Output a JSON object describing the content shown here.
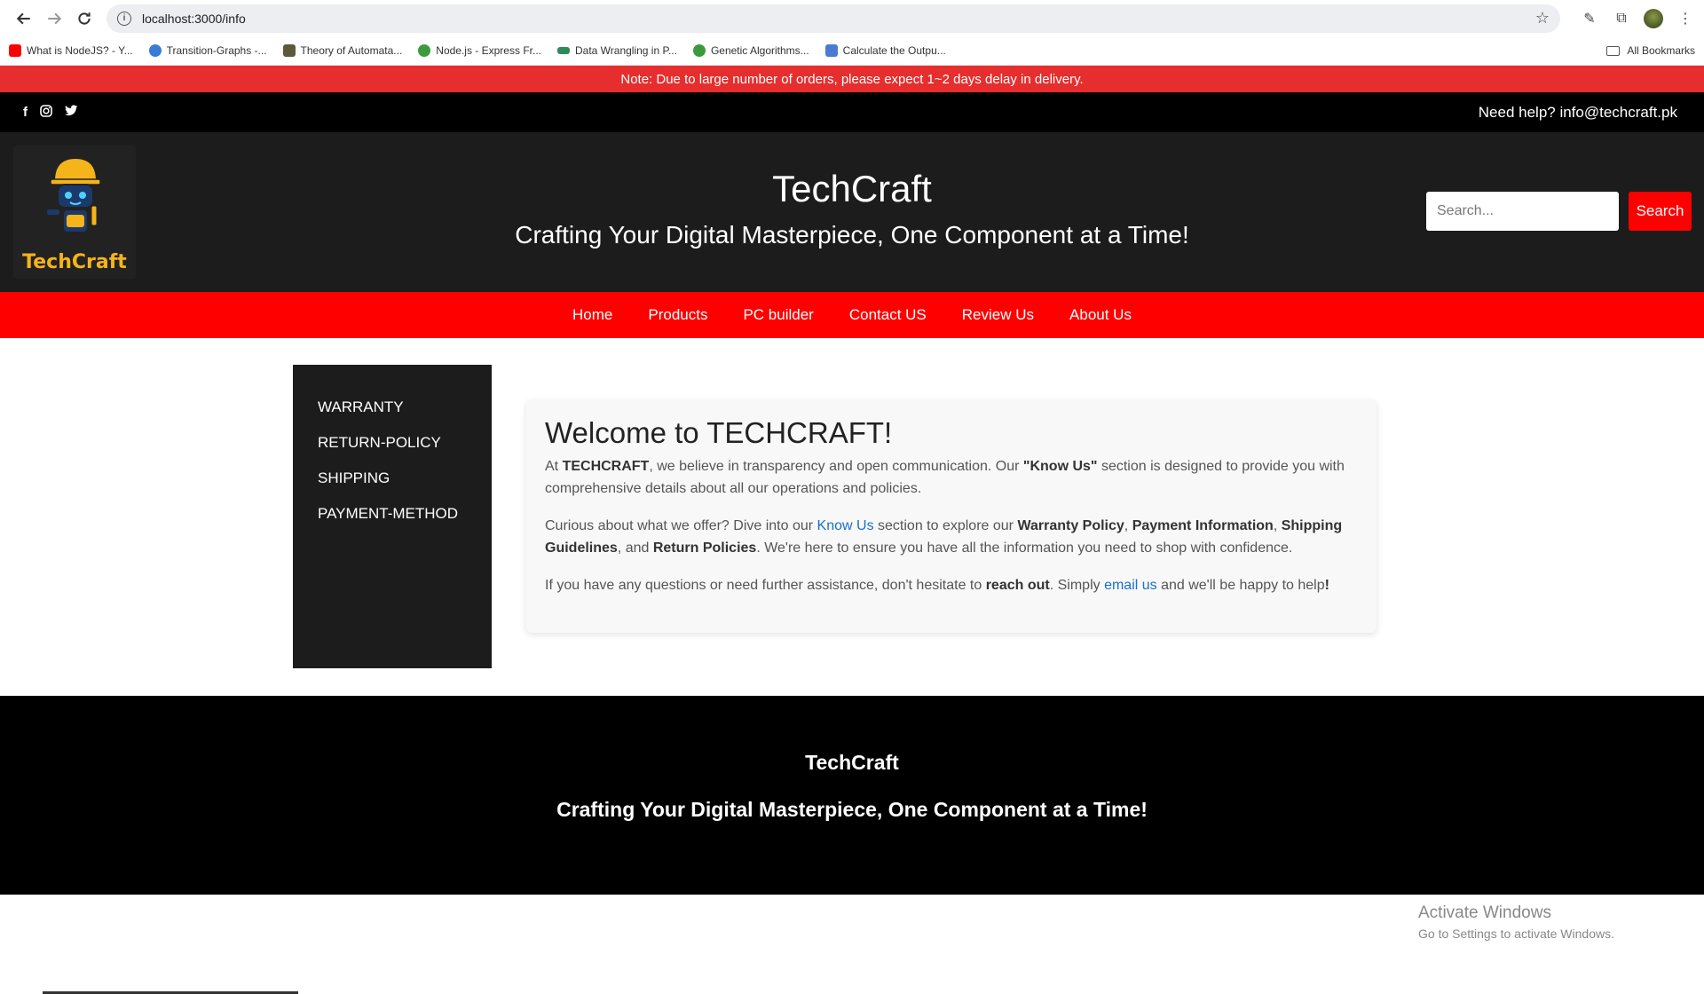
{
  "browser": {
    "url": "localhost:3000/info",
    "bookmarks": [
      {
        "label": "What is NodeJS? - Y...",
        "color": "#ff0000"
      },
      {
        "label": "Transition-Graphs -...",
        "color": "#3a7bd5"
      },
      {
        "label": "Theory of Automata...",
        "color": "#5a5a3a"
      },
      {
        "label": "Node.js - Express Fr...",
        "color": "#3c9a3c"
      },
      {
        "label": "Data Wrangling in P...",
        "color": "#2e8b57"
      },
      {
        "label": "Genetic Algorithms...",
        "color": "#3c9a3c"
      },
      {
        "label": "Calculate the Outpu...",
        "color": "#4a7bd0"
      }
    ],
    "all_bookmarks": "All Bookmarks"
  },
  "notice": "Note: Due to large number of orders, please expect 1~2 days delay in delivery.",
  "topbar": {
    "help": "Need help? info@techcraft.pk"
  },
  "header": {
    "logo_text": "TechCraft",
    "title": "TechCraft",
    "tagline": "Crafting Your Digital Masterpiece, One Component at a Time!",
    "search_placeholder": "Search...",
    "search_button": "Search"
  },
  "nav": [
    "Home",
    "Products",
    "PC builder",
    "Contact US",
    "Review Us",
    "About Us"
  ],
  "sidebar": [
    "WARRANTY",
    "RETURN-POLICY",
    "SHIPPING",
    "PAYMENT-METHOD"
  ],
  "card": {
    "title": "Welcome to TECHCRAFT!",
    "p1_a": "At ",
    "p1_b": "TECHCRAFT",
    "p1_c": ", we believe in transparency and open communication. Our ",
    "p1_d": "\"Know Us\"",
    "p1_e": " section is designed to provide you with comprehensive details about all our operations and policies.",
    "p2_a": "Curious about what we offer? Dive into our ",
    "p2_link": "Know Us",
    "p2_b": " section to explore our ",
    "p2_c": "Warranty Policy",
    "p2_d": ", ",
    "p2_e": "Payment Information",
    "p2_f": ", ",
    "p2_g": "Shipping Guidelines",
    "p2_h": ", and ",
    "p2_i": "Return Policies",
    "p2_j": ". We're here to ensure you have all the information you need to shop with confidence.",
    "p3_a": "If you have any questions or need further assistance, don't hesitate to ",
    "p3_b": "reach out",
    "p3_c": ". Simply ",
    "p3_link": "email us",
    "p3_d": " and we'll be happy to help",
    "p3_e": "!"
  },
  "footer": {
    "title": "TechCraft",
    "tagline": "Crafting Your Digital Masterpiece, One Component at a Time!"
  },
  "activate": {
    "line1": "Activate Windows",
    "line2": "Go to Settings to activate Windows."
  }
}
